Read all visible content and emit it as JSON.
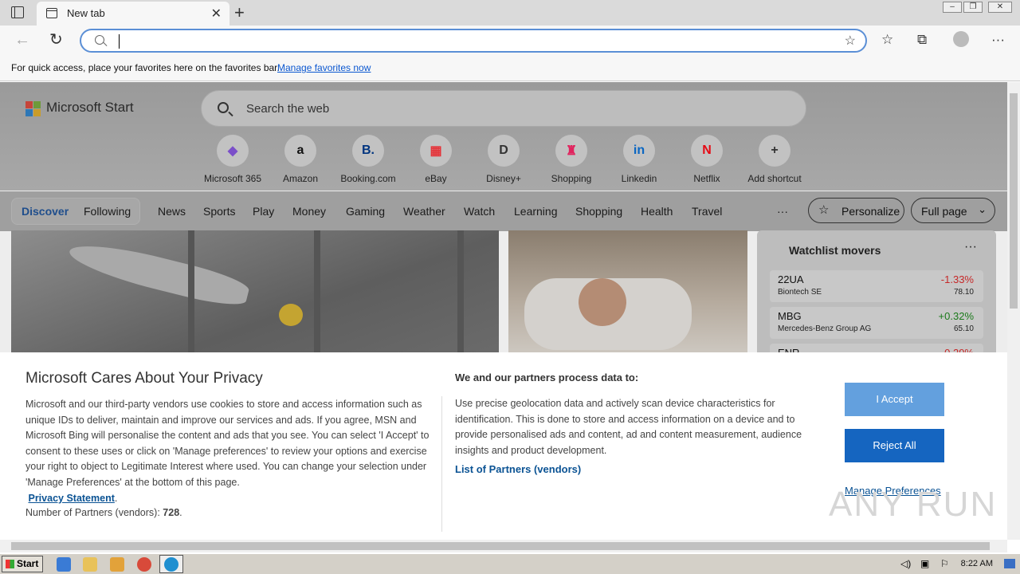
{
  "browser": {
    "tab_title": "New tab",
    "favbar_message": "For quick access, place your favorites here on the favorites bar.",
    "favbar_link": "Manage favorites now"
  },
  "msstart": {
    "logo_text": "Microsoft Start",
    "search_placeholder": "Search the web",
    "shortcuts": [
      {
        "label": "Microsoft 365",
        "glyph": "◆",
        "color": "#7b4fc9"
      },
      {
        "label": "Amazon",
        "glyph": "a",
        "color": "#111"
      },
      {
        "label": "Booking.com",
        "glyph": "B.",
        "color": "#003580"
      },
      {
        "label": "eBay",
        "glyph": "▦",
        "color": "#e53238"
      },
      {
        "label": "Disney+",
        "glyph": "D",
        "color": "#333"
      },
      {
        "label": "Shopping",
        "glyph": "♜",
        "color": "#e0245e"
      },
      {
        "label": "Linkedin",
        "glyph": "in",
        "color": "#0a66c2"
      },
      {
        "label": "Netflix",
        "glyph": "N",
        "color": "#e50914"
      },
      {
        "label": "Add shortcut",
        "glyph": "+",
        "color": "#333"
      }
    ],
    "nav": {
      "discover": "Discover",
      "following": "Following",
      "items": [
        "News",
        "Sports",
        "Play",
        "Money",
        "Gaming",
        "Weather",
        "Watch",
        "Learning",
        "Shopping",
        "Health",
        "Travel"
      ],
      "more": "···",
      "personalize": "Personalize",
      "fullpage": "Full page"
    },
    "watchlist": {
      "title": "Watchlist movers",
      "more": "···",
      "rows": [
        {
          "symbol": "22UA",
          "name": "Biontech SE",
          "change": "-1.33%",
          "price": "78.10"
        },
        {
          "symbol": "MBG",
          "name": "Mercedes-Benz Group AG",
          "change": "+0.32%",
          "price": "65.10"
        },
        {
          "symbol": "ENR",
          "name": "",
          "change": "-0.29%",
          "price": ""
        }
      ]
    }
  },
  "privacy": {
    "title": "Microsoft Cares About Your Privacy",
    "body": "Microsoft and our third-party vendors use cookies to store and access information such as unique IDs to deliver, maintain and improve our services and ads. If you agree, MSN and Microsoft Bing will personalise the content and ads that you see. You can select 'I Accept' to consent to these uses or click on 'Manage preferences' to review your options and exercise your right to object to Legitimate Interest where used.  You can change your selection under 'Manage Preferences' at the bottom of this page.",
    "privacy_link": "Privacy Statement",
    "partners_label": "Number of Partners (vendors):",
    "partners_count": "728",
    "we_title": "We and our partners process data to:",
    "we_body": "Use precise geolocation data and actively scan device characteristics for identification. This is done to store and access information on a device and to provide personalised ads and content, ad and content measurement, audience insights and product development.",
    "vendors_link": "List of Partners (vendors)",
    "accept": "I Accept",
    "reject": "Reject All",
    "manage": "Manage Preferences"
  },
  "taskbar": {
    "start": "Start",
    "clock": "8:22 AM"
  },
  "watermark": "ANY RUN"
}
